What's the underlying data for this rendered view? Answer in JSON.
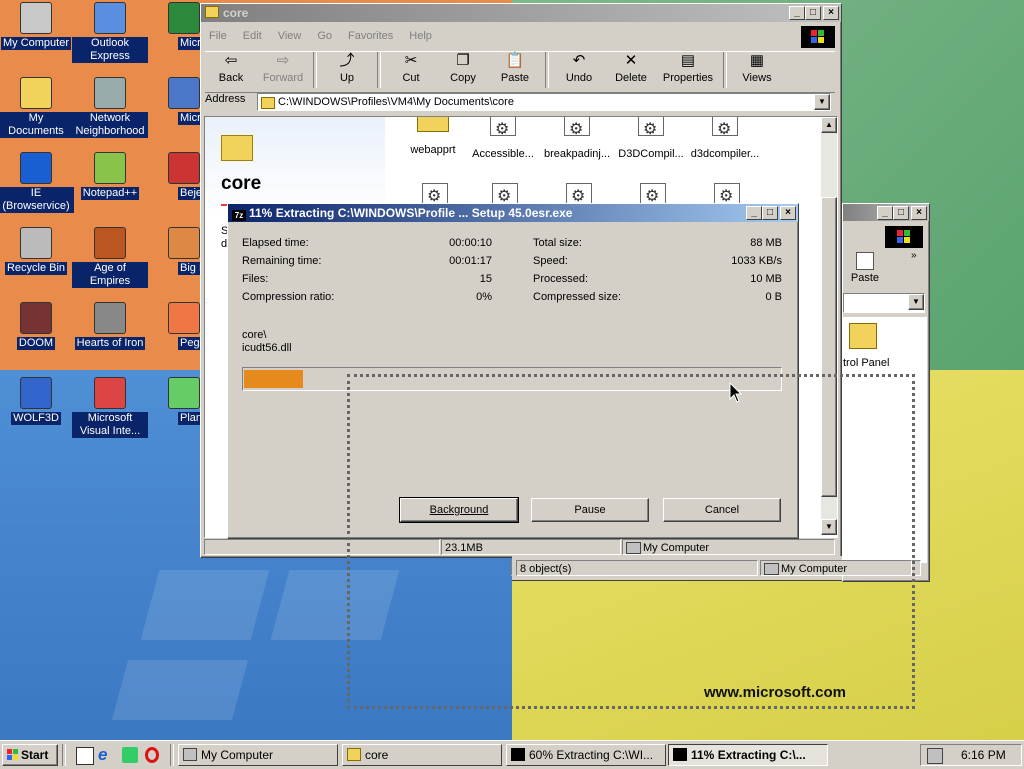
{
  "desktop": {
    "icons": [
      {
        "label": "My Computer",
        "icon": "my-computer-icon"
      },
      {
        "label": "Outlook Express",
        "icon": "outlook-express-icon"
      },
      {
        "label": "Microsoft Excel",
        "icon": "excel-icon"
      },
      {
        "label": "My Documents",
        "icon": "my-documents-icon"
      },
      {
        "label": "Network Neighborhood",
        "icon": "network-icon"
      },
      {
        "label": "Microsoft FrontPage",
        "icon": "frontpage-icon"
      },
      {
        "label": "IE (Browservice)",
        "icon": "ie-icon"
      },
      {
        "label": "Notepad++",
        "icon": "notepadpp-icon"
      },
      {
        "label": "Bejeweled Deluxe",
        "icon": "bejeweled-icon"
      },
      {
        "label": "Recycle Bin",
        "icon": "recycle-bin-icon"
      },
      {
        "label": "Age of Empires",
        "icon": "age-of-empires-icon"
      },
      {
        "label": "Big Money Deluxe",
        "icon": "big-money-icon"
      },
      {
        "label": "DOOM",
        "icon": "doom-icon"
      },
      {
        "label": "Hearts of Iron",
        "icon": "hearts-of-iron-icon"
      },
      {
        "label": "Peggle Deluxe",
        "icon": "peggle-icon"
      },
      {
        "label": "WOLF3D",
        "icon": "wolf3d-icon"
      },
      {
        "label": "Microsoft Visual Inte...",
        "icon": "visual-interdev-icon"
      },
      {
        "label": "Plants vs Zombies",
        "icon": "plants-vs-zombies-icon"
      }
    ],
    "wallpaper_text": "www.microsoft.com"
  },
  "explorer": {
    "title": "core",
    "menu": [
      "File",
      "Edit",
      "View",
      "Go",
      "Favorites",
      "Help"
    ],
    "toolbar": [
      "Back",
      "Forward",
      "Up",
      "Cut",
      "Copy",
      "Paste",
      "Undo",
      "Delete",
      "Properties",
      "Views"
    ],
    "address_label": "Address",
    "address": "C:\\WINDOWS\\Profiles\\VM4\\My Documents\\core",
    "folder_heading": "core",
    "side_letters": [
      "S",
      "d"
    ],
    "files": [
      "webapprt",
      "Accessible...",
      "breakpadinj...",
      "D3DCompil...",
      "d3dcompiler..."
    ],
    "status": {
      "size": "23.1MB",
      "zone": "My Computer"
    }
  },
  "mycomputer": {
    "toolbar_label": "Paste",
    "item": "Control Panel",
    "item_visible": "trol Panel",
    "status": {
      "objects": "8 object(s)",
      "zone": "My Computer"
    }
  },
  "extract": {
    "title": "11% Extracting C:\\WINDOWS\\Profile ...  Setup 45.0esr.exe",
    "stats_left": [
      {
        "k": "Elapsed time:",
        "v": "00:00:10"
      },
      {
        "k": "Remaining time:",
        "v": "00:01:17"
      },
      {
        "k": "Files:",
        "v": "15"
      },
      {
        "k": "Compression ratio:",
        "v": "0%"
      }
    ],
    "stats_right": [
      {
        "k": "Total size:",
        "v": "88 MB"
      },
      {
        "k": "Speed:",
        "v": "1033 KB/s"
      },
      {
        "k": "Processed:",
        "v": "10 MB"
      },
      {
        "k": "Compressed size:",
        "v": "0 B"
      }
    ],
    "path": "core\\",
    "file": "icudt56.dll",
    "progress_percent": 11,
    "buttons": {
      "background": "Background",
      "pause": "Pause",
      "cancel": "Cancel"
    },
    "accent": "#e68a1e"
  },
  "taskbar": {
    "start": "Start",
    "tasks": [
      {
        "label": "My Computer",
        "pressed": false
      },
      {
        "label": "core",
        "pressed": false
      },
      {
        "label": "60% Extracting C:\\WI...",
        "pressed": false
      },
      {
        "label": "11% Extracting C:\\...",
        "pressed": true
      }
    ],
    "clock": "6:16 PM"
  }
}
